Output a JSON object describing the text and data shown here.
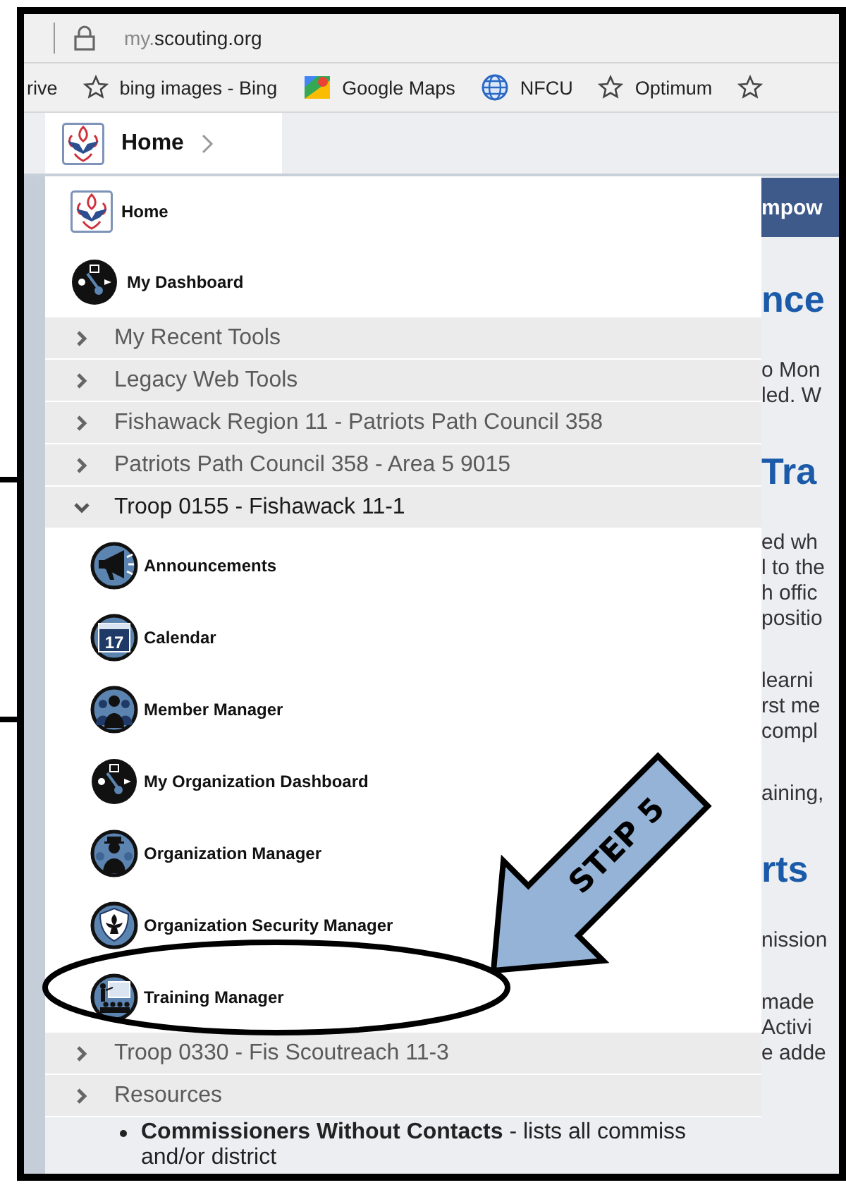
{
  "browser": {
    "url": {
      "subdomain": "my.",
      "domain": "scouting.org"
    },
    "bookmarks": [
      {
        "label": "rive"
      },
      {
        "label": "bing images - Bing"
      },
      {
        "label": "Google Maps"
      },
      {
        "label": "NFCU"
      },
      {
        "label": "Optimum"
      }
    ]
  },
  "breadcrumb": {
    "label": "Home"
  },
  "menu": {
    "top_items": [
      {
        "label": "Home"
      },
      {
        "label": "My Dashboard"
      }
    ],
    "sections": [
      {
        "label": "My Recent Tools",
        "expanded": false
      },
      {
        "label": "Legacy Web Tools",
        "expanded": false
      },
      {
        "label": "Fishawack Region 11 - Patriots Path Council 358",
        "expanded": false
      },
      {
        "label": "Patriots Path Council 358 - Area 5 9015",
        "expanded": false
      },
      {
        "label": "Troop 0155 - Fishawack 11-1",
        "expanded": true,
        "children": [
          {
            "label": "Announcements"
          },
          {
            "label": "Calendar",
            "icon_text": "17"
          },
          {
            "label": "Member Manager"
          },
          {
            "label": "My Organization Dashboard"
          },
          {
            "label": "Organization Manager"
          },
          {
            "label": "Organization Security Manager"
          },
          {
            "label": "Training Manager"
          }
        ]
      },
      {
        "label": "Troop 0330 - Fis Scoutreach 11-3",
        "expanded": false
      },
      {
        "label": "Resources",
        "expanded": false
      }
    ]
  },
  "page": {
    "banner": "mpow",
    "fragments": [
      {
        "kind": "heading",
        "text": "nce"
      },
      {
        "kind": "paragraph",
        "lines": [
          "o Mon",
          "led. W"
        ]
      },
      {
        "kind": "heading",
        "text": "Tra"
      },
      {
        "kind": "paragraph",
        "lines": [
          "ed wh",
          "l to the",
          "h offic",
          "positio"
        ]
      },
      {
        "kind": "paragraph",
        "lines": [
          "learni",
          "rst me",
          "compl"
        ]
      },
      {
        "kind": "paragraph",
        "lines": [
          "aining,"
        ]
      },
      {
        "kind": "heading",
        "text": "rts"
      },
      {
        "kind": "paragraph",
        "lines": [
          "nission"
        ]
      },
      {
        "kind": "paragraph",
        "lines": [
          "made",
          "Activi",
          "e adde"
        ]
      }
    ],
    "bullets": [
      {
        "text": "**Commissioners Without Contacts** - lists all commiss",
        "continuation": "and/or district"
      }
    ]
  },
  "annotation": {
    "arrow_label": "STEP 5"
  }
}
